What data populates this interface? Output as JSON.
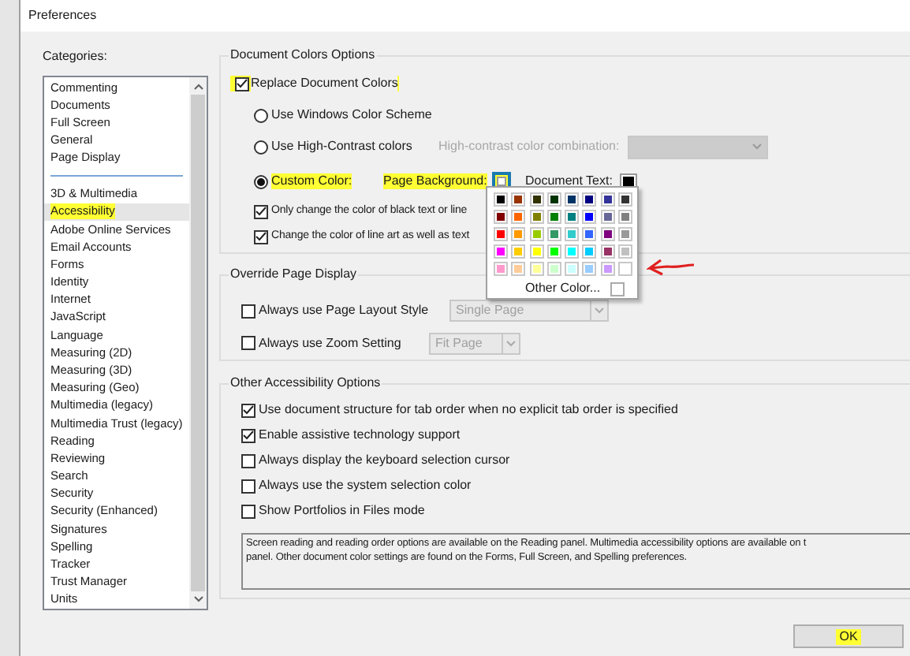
{
  "window": {
    "title": "Preferences"
  },
  "categories": {
    "label": "Categories:",
    "items": [
      {
        "kind": "item",
        "label": "Commenting",
        "selected": false
      },
      {
        "kind": "item",
        "label": "Documents",
        "selected": false
      },
      {
        "kind": "item",
        "label": "Full Screen",
        "selected": false
      },
      {
        "kind": "item",
        "label": "General",
        "selected": false
      },
      {
        "kind": "item",
        "label": "Page Display",
        "selected": false
      },
      {
        "kind": "separator"
      },
      {
        "kind": "item",
        "label": "3D & Multimedia",
        "selected": false
      },
      {
        "kind": "item",
        "label": "Accessibility",
        "selected": true,
        "highlighted": true
      },
      {
        "kind": "item",
        "label": "Adobe Online Services",
        "selected": false
      },
      {
        "kind": "item",
        "label": "Email Accounts",
        "selected": false
      },
      {
        "kind": "item",
        "label": "Forms",
        "selected": false
      },
      {
        "kind": "item",
        "label": "Identity",
        "selected": false
      },
      {
        "kind": "item",
        "label": "Internet",
        "selected": false
      },
      {
        "kind": "item",
        "label": "JavaScript",
        "selected": false
      },
      {
        "kind": "item",
        "label": "Language",
        "selected": false
      },
      {
        "kind": "item",
        "label": "Measuring (2D)",
        "selected": false
      },
      {
        "kind": "item",
        "label": "Measuring (3D)",
        "selected": false
      },
      {
        "kind": "item",
        "label": "Measuring (Geo)",
        "selected": false
      },
      {
        "kind": "item",
        "label": "Multimedia (legacy)",
        "selected": false
      },
      {
        "kind": "item",
        "label": "Multimedia Trust (legacy)",
        "selected": false
      },
      {
        "kind": "item",
        "label": "Reading",
        "selected": false
      },
      {
        "kind": "item",
        "label": "Reviewing",
        "selected": false
      },
      {
        "kind": "item",
        "label": "Search",
        "selected": false
      },
      {
        "kind": "item",
        "label": "Security",
        "selected": false
      },
      {
        "kind": "item",
        "label": "Security (Enhanced)",
        "selected": false
      },
      {
        "kind": "item",
        "label": "Signatures",
        "selected": false
      },
      {
        "kind": "item",
        "label": "Spelling",
        "selected": false
      },
      {
        "kind": "item",
        "label": "Tracker",
        "selected": false
      },
      {
        "kind": "item",
        "label": "Trust Manager",
        "selected": false
      },
      {
        "kind": "item",
        "label": "Units",
        "selected": false
      }
    ]
  },
  "document_colors": {
    "title": "Document Colors Options",
    "replace": {
      "label": "Replace Document Colors",
      "checked": true,
      "highlighted": true
    },
    "options": [
      {
        "label": "Use Windows Color Scheme",
        "selected": false
      },
      {
        "label": "Use High-Contrast colors",
        "selected": false,
        "combo_label": "High-contrast color combination:",
        "combo_disabled": true
      },
      {
        "label": "Custom Color:",
        "selected": true,
        "highlighted": true
      }
    ],
    "custom": {
      "page_background_label": "Page Background:",
      "page_background_highlighted": true,
      "document_text_label": "Document Text:"
    },
    "checks": [
      {
        "label": "Only change the color of black text or line",
        "checked": true
      },
      {
        "label": "Change the color of line art as well as text",
        "checked": true
      }
    ],
    "palette": {
      "rows": [
        [
          {
            "color": "#000000"
          },
          {
            "color": "#993300"
          },
          {
            "color": "#333300"
          },
          {
            "color": "#003300"
          },
          {
            "color": "#003366"
          },
          {
            "color": "#000080"
          },
          {
            "color": "#333399"
          },
          {
            "color": "#333333"
          }
        ],
        [
          {
            "color": "#800000"
          },
          {
            "color": "#ff6600"
          },
          {
            "color": "#808000"
          },
          {
            "color": "#008000"
          },
          {
            "color": "#008080"
          },
          {
            "color": "#0000ff"
          },
          {
            "color": "#666699"
          },
          {
            "color": "#808080"
          }
        ],
        [
          {
            "color": "#ff0000"
          },
          {
            "color": "#ff9900"
          },
          {
            "color": "#99cc00"
          },
          {
            "color": "#339966"
          },
          {
            "color": "#33cccc"
          },
          {
            "color": "#3366ff"
          },
          {
            "color": "#800080"
          },
          {
            "color": "#999999"
          }
        ],
        [
          {
            "color": "#ff00ff"
          },
          {
            "color": "#ffcc00"
          },
          {
            "color": "#ffff00"
          },
          {
            "color": "#00ff00"
          },
          {
            "color": "#00ffff"
          },
          {
            "color": "#00ccff"
          },
          {
            "color": "#993366"
          },
          {
            "color": "#c0c0c0"
          }
        ],
        [
          {
            "color": "#ff99cc"
          },
          {
            "color": "#ffcc99"
          },
          {
            "color": "#ffff99"
          },
          {
            "color": "#ccffcc"
          },
          {
            "color": "#ccffff"
          },
          {
            "color": "#99ccff"
          },
          {
            "color": "#cc99ff"
          },
          {
            "color": "#ffffff"
          }
        ]
      ],
      "other_label": "Other Color..."
    }
  },
  "override_page_display": {
    "title": "Override Page Display",
    "rows": [
      {
        "label": "Always use Page Layout Style",
        "checked": false,
        "value": "Single Page",
        "disabled": true
      },
      {
        "label": "Always use Zoom Setting",
        "checked": false,
        "value": "Fit Page",
        "disabled": true
      }
    ]
  },
  "other_accessibility": {
    "title": "Other Accessibility Options",
    "checks": [
      {
        "label": "Use document structure for tab order when no explicit tab order is specified",
        "checked": true
      },
      {
        "label": "Enable assistive technology support",
        "checked": true
      },
      {
        "label": "Always display the keyboard selection cursor",
        "checked": false
      },
      {
        "label": "Always use the system selection color",
        "checked": false
      },
      {
        "label": "Show Portfolios in Files mode",
        "checked": false
      }
    ],
    "info_lines": [
      "Screen reading and reading order options are available on the Reading panel. Multimedia accessibility options are available on t",
      "panel. Other document color settings are found on the Forms, Full Screen, and Spelling preferences."
    ]
  },
  "ok_button": {
    "label": "OK",
    "highlighted": true
  }
}
